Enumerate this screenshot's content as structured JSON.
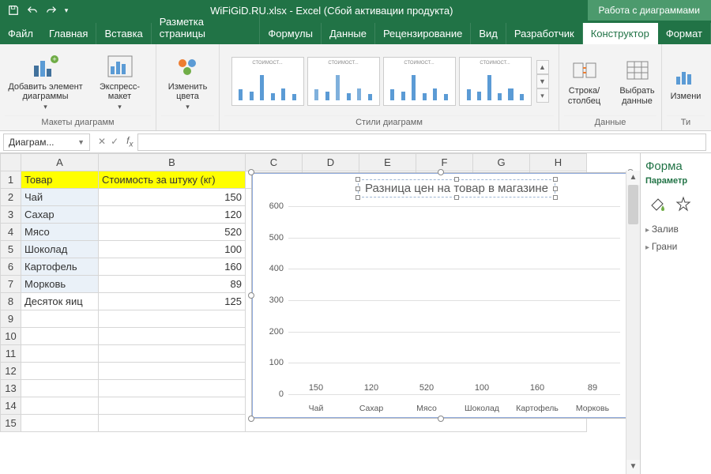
{
  "titlebar": {
    "filename": "WiFiGiD.RU.xlsx - Excel (Сбой активации продукта)",
    "tool_context": "Работа с диаграммами"
  },
  "tabs": {
    "file": "Файл",
    "home": "Главная",
    "insert": "Вставка",
    "layout": "Разметка страницы",
    "formulas": "Формулы",
    "data": "Данные",
    "review": "Рецензирование",
    "view": "Вид",
    "developer": "Разработчик",
    "design": "Конструктор",
    "format": "Формат"
  },
  "ribbon": {
    "add_element": "Добавить элемент диаграммы",
    "quick_layout": "Экспресс-макет",
    "change_colors": "Изменить цвета",
    "group_layouts": "Макеты диаграмм",
    "group_styles": "Стили диаграмм",
    "switch_rc": "Строка/столбец",
    "select_data": "Выбрать данные",
    "group_data": "Данные",
    "change_type": "Измени",
    "group_type": "Ти",
    "thumb_title": "СТОИМОСТ..."
  },
  "namebox": "Диаграм...",
  "grid": {
    "cols": [
      "A",
      "B",
      "C",
      "D",
      "E",
      "F",
      "G",
      "H"
    ],
    "header_a": "Товар",
    "header_b": "Стоимость за штуку (кг)",
    "rows": [
      {
        "a": "Чай",
        "b": "150"
      },
      {
        "a": "Сахар",
        "b": "120"
      },
      {
        "a": "Мясо",
        "b": "520"
      },
      {
        "a": "Шоколад",
        "b": "100"
      },
      {
        "a": "Картофель",
        "b": "160"
      },
      {
        "a": "Морковь",
        "b": "89"
      },
      {
        "a": "Десяток яиц",
        "b": "125"
      }
    ]
  },
  "chart_data": {
    "type": "bar",
    "title": "Разница цен на товар в магазине",
    "categories": [
      "Чай",
      "Сахар",
      "Мясо",
      "Шоколад",
      "Картофель",
      "Морковь"
    ],
    "values": [
      150,
      120,
      520,
      100,
      160,
      89
    ],
    "ylim": [
      0,
      600
    ],
    "ystep": 100,
    "xlabel": "",
    "ylabel": ""
  },
  "sidepane": {
    "title": "Форма",
    "subtitle": "Параметр",
    "fill": "Залив",
    "border": "Грани"
  }
}
